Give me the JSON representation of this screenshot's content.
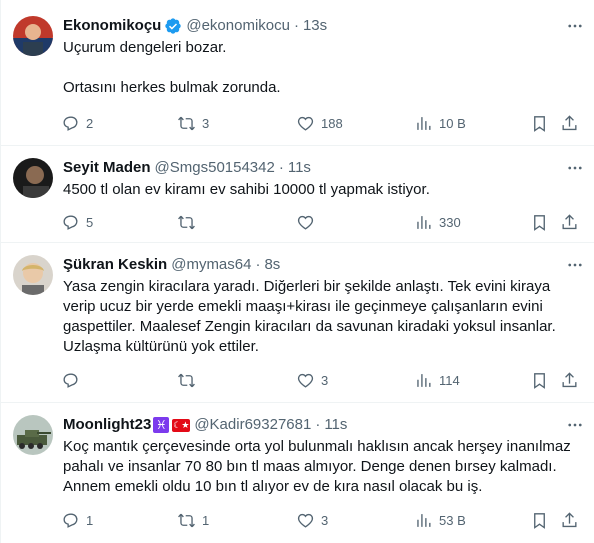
{
  "tweets": [
    {
      "name": "Ekonomikoçu",
      "handle": "@ekonomikocu",
      "time": "13s",
      "verified": true,
      "text": "Uçurum dengeleri bozar.\n\nOrtasını herkes bulmak zorunda.",
      "replies": "2",
      "retweets": "3",
      "likes": "188",
      "views": "10 B"
    },
    {
      "name": "Seyit Maden",
      "handle": "@Smgs50154342",
      "time": "11s",
      "text": "4500 tl olan ev kiramı ev sahibi 10000 tl yapmak istiyor.",
      "replies": "5",
      "retweets": "",
      "likes": "",
      "views": "330"
    },
    {
      "name": "Şükran Keskin",
      "handle": "@mymas64",
      "time": "8s",
      "text": "Yasa zengin kiracılara yaradı. Diğerleri bir şekilde anlaştı. Tek evini kiraya verip ucuz bir yerde emekli maaşı+kirası ile geçinmeye çalışanların evini gaspettiler. Maalesef Zengin kiracıları da savunan kiradaki yoksul insanlar. Uzlaşma kültürünü yok ettiler.",
      "replies": "",
      "retweets": "",
      "likes": "3",
      "views": "114"
    },
    {
      "name": "Moonlight23",
      "handle": "@Kadir69327681",
      "time": "11s",
      "name_emoji_1": "♓",
      "name_emoji_2": "☾★",
      "text": "Koç mantık çerçevesinde orta yol bulunmalı haklısın ancak herşey inanılmaz pahalı ve insanlar 70 80 bın tl maas almıyor. Denge denen bırsey kalmadı. Annem emekli oldu 10 bın tl alıyor ev de kıra nasıl olacak bu iş.",
      "replies": "1",
      "retweets": "1",
      "likes": "3",
      "views": "53 B"
    }
  ],
  "colors": {
    "verified": "#1d9bf0",
    "secondary": "#536471",
    "border": "#eff3f4"
  },
  "icons": [
    "verified-badge-icon",
    "more-icon",
    "reply-icon",
    "retweet-icon",
    "like-icon",
    "views-icon",
    "bookmark-icon",
    "share-icon"
  ]
}
